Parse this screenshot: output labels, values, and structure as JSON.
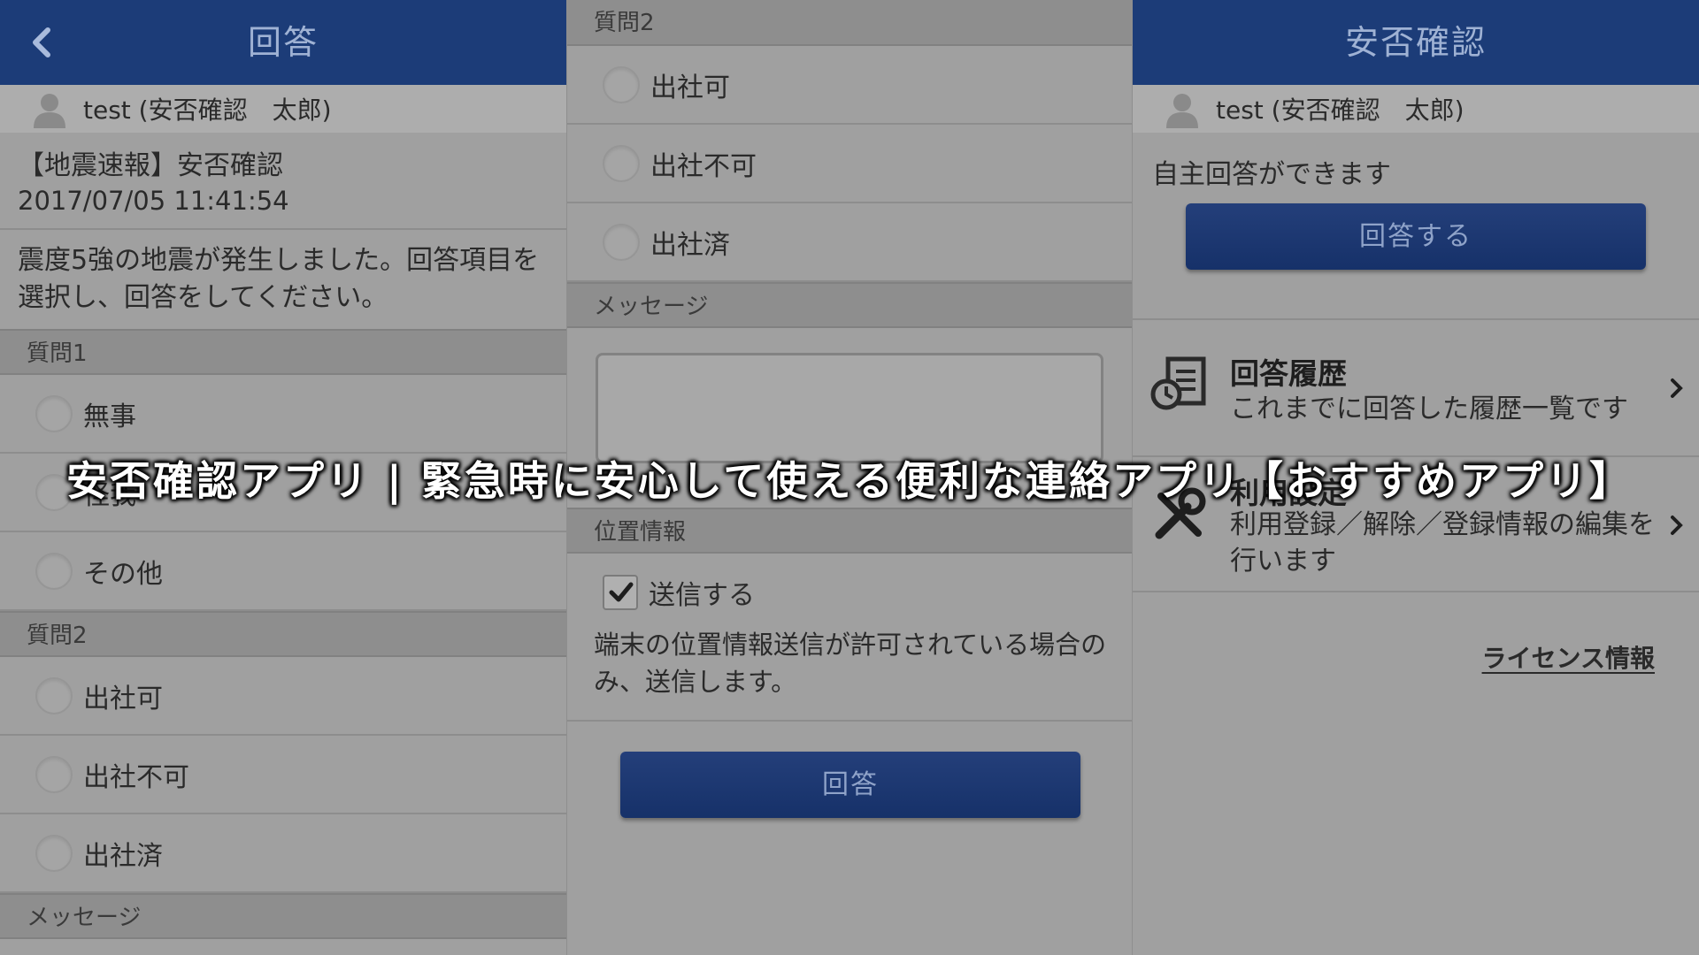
{
  "left": {
    "header_title": "回答",
    "user": "test (安否確認　太郎)",
    "notice_title": "【地震速報】安否確認",
    "notice_date": "2017/07/05 11:41:54",
    "notice_body": "震度5強の地震が発生しました。回答項目を選択し、回答をしてください。",
    "q1_label": "質問1",
    "q1_options": [
      "無事",
      "怪我",
      "その他"
    ],
    "q2_label": "質問2",
    "q2_options": [
      "出社可",
      "出社不可",
      "出社済"
    ],
    "message_label": "メッセージ"
  },
  "middle": {
    "q2_label": "質問2",
    "q2_options": [
      "出社可",
      "出社不可",
      "出社済"
    ],
    "message_label": "メッセージ",
    "message_value": "",
    "location_label": "位置情報",
    "send_label": "送信する",
    "send_checked": true,
    "location_note": "端末の位置情報送信が許可されている場合のみ、送信します。",
    "answer_button": "回答"
  },
  "right": {
    "header_title": "安否確認",
    "user": "test (安否確認　太郎)",
    "self_answer_text": "自主回答ができます",
    "respond_button": "回答する",
    "history_title": "回答履歴",
    "history_desc": "これまでに回答した履歴一覧です",
    "settings_title": "利用設定",
    "settings_desc": "利用登録／解除／登録情報の編集を行います",
    "license_link": "ライセンス情報"
  },
  "overlay_title": "安否確認アプリ | 緊急時に安心して使える便利な連絡アプリ【おすすめアプリ】",
  "colors": {
    "header_blue": "#1c3c78",
    "button_blue": "#1f3a74",
    "panel_gray": "#a0a0a0"
  },
  "icons": [
    "back-arrow-icon",
    "user-avatar-icon",
    "history-document-icon",
    "settings-tools-icon",
    "chevron-right-icon",
    "checkmark-icon"
  ]
}
